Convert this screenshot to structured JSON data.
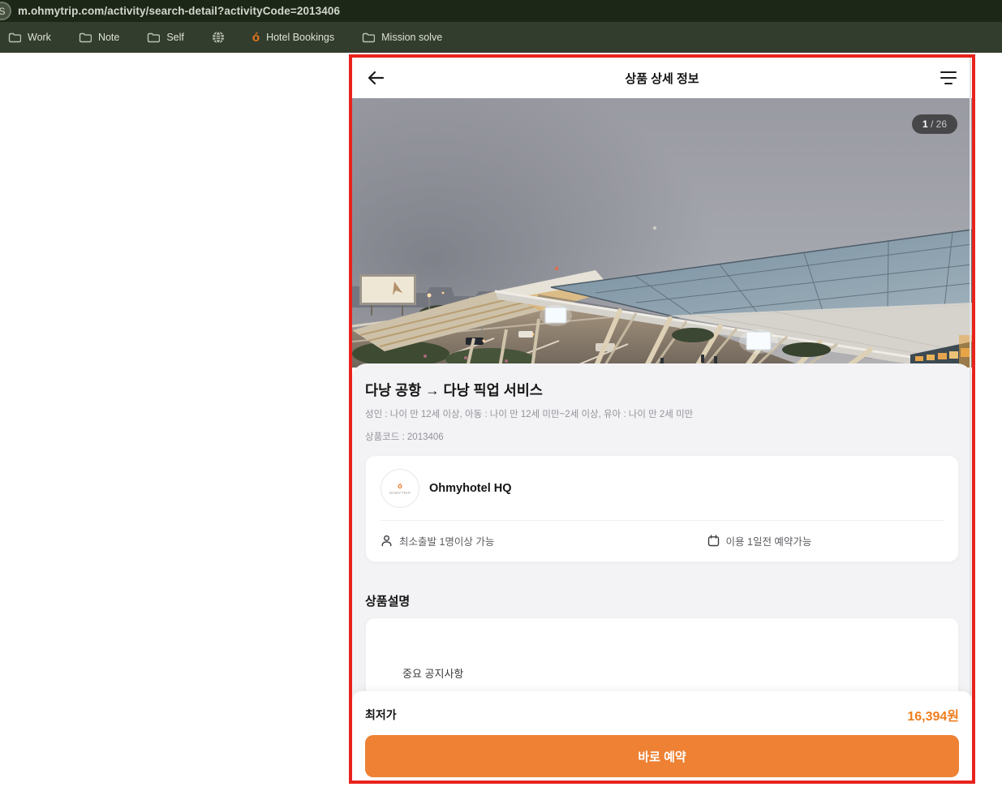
{
  "browser": {
    "url": "m.ohmytrip.com/activity/search-detail?activityCode=2013406",
    "favicon_letter": "S",
    "bookmarks": [
      {
        "label": "Work",
        "icon": "folder-icon"
      },
      {
        "label": "Note",
        "icon": "folder-icon"
      },
      {
        "label": "Self",
        "icon": "folder-icon"
      },
      {
        "label": "",
        "icon": "globe-icon"
      },
      {
        "label": "Hotel Bookings",
        "icon": "ohmytrip-icon",
        "glyph": "ó"
      },
      {
        "label": "Mission solve",
        "icon": "folder-icon"
      }
    ]
  },
  "app": {
    "header": {
      "title": "상품 상세 정보"
    },
    "gallery": {
      "current": "1",
      "separator": " / ",
      "total": "26"
    },
    "product": {
      "title": "다낭 공항 → 다낭 픽업 서비스",
      "age_note": "성인 : 나이 만 12세 이상, 아동 : 나이 만 12세 미만~2세 이상, 유아 : 나이 만 2세 미만",
      "code": "상품코드 : 2013406"
    },
    "vendor": {
      "name": "Ohmyhotel HQ",
      "logo_glyph": "ó",
      "logo_brand": "OHMYTRIP",
      "min_departure": "최소출발 1명이상 가능",
      "lead_time": "이용 1일전 예약가능"
    },
    "description": {
      "heading": "상품설명",
      "notice": "중요 공지사항"
    },
    "footer": {
      "price_label": "최저가",
      "price": "16,394원",
      "cta": "바로 예약"
    }
  },
  "colors": {
    "accent_orange": "#ee8133",
    "price_orange": "#ef7e1e",
    "annotation_red": "#e8231d",
    "chrome_dark": "#1d2718",
    "bookmarks_bar": "#323d2d",
    "sheet_gray": "#f3f3f5"
  }
}
